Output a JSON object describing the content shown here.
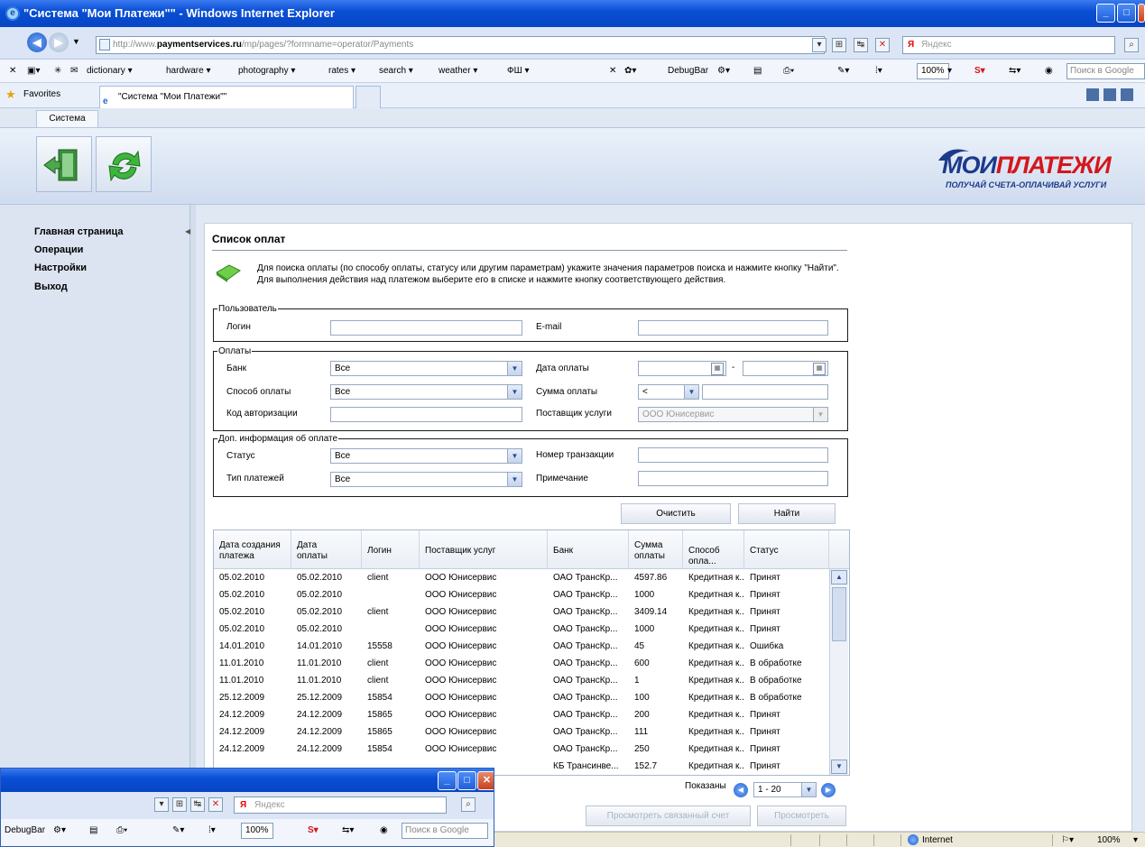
{
  "window": {
    "title": "\"Система \"Мои Платежи\"\" - Windows Internet Explorer"
  },
  "address": {
    "host_prefix": "http://www.",
    "host": "paymentservices.ru",
    "path": "/mp/pages/?formname=operator/Payments"
  },
  "yandex": {
    "logo": "Я",
    "placeholder": "Яндекс"
  },
  "links_toolbar": {
    "items": [
      "dictionary ▾",
      "hardware ▾",
      "photography ▾",
      "rates ▾",
      "search ▾",
      "weather ▾",
      "ФШ ▾"
    ],
    "debugbar": "DebugBar",
    "zoom": "100%",
    "google_placeholder": "Поиск в Google"
  },
  "favorites": {
    "label": "Favorites",
    "tab_title": "\"Система \"Мои Платежи\"\""
  },
  "app": {
    "top_tab": "Система",
    "logo_main_1": "МОИ",
    "logo_main_2": "ПЛАТЕЖИ",
    "logo_slogan": "ПОЛУЧАЙ СЧЕТА-ОПЛАЧИВАЙ УСЛУГИ"
  },
  "sidebar": {
    "items": [
      "Главная страница",
      "Операции",
      "Настройки",
      "Выход"
    ]
  },
  "page": {
    "title": "Список оплат",
    "info": "Для поиска оплаты (по способу оплаты, статусу или другим параметрам) укажите значения параметров поиска и нажмите кнопку \"Найти\". Для выполнения действия над платежом выберите его в списке и нажмите кнопку соответствующего действия."
  },
  "filters": {
    "user": {
      "legend": "Пользователь",
      "login_label": "Логин",
      "email_label": "E-mail"
    },
    "payments": {
      "legend": "Оплаты",
      "bank_label": "Банк",
      "bank_value": "Все",
      "method_label": "Способ оплаты",
      "method_value": "Все",
      "auth_label": "Код авторизации",
      "date_label": "Дата оплаты",
      "date_sep": "-",
      "sum_label": "Сумма оплаты",
      "sum_op": "<",
      "provider_label": "Поставщик услуги",
      "provider_value": "ООО Юнисервис"
    },
    "extra": {
      "legend": "Доп. информация об оплате",
      "status_label": "Статус",
      "status_value": "Все",
      "type_label": "Тип платежей",
      "type_value": "Все",
      "txn_label": "Номер транзакции",
      "note_label": "Примечание"
    }
  },
  "buttons": {
    "clear": "Очистить",
    "find": "Найти",
    "view_invoice": "Просмотреть связанный счет",
    "view": "Просмотреть"
  },
  "grid": {
    "headers": [
      [
        "Дата создания",
        "платежа"
      ],
      [
        "Дата",
        "оплаты"
      ],
      [
        "Логин",
        ""
      ],
      [
        "Поставщик услуг",
        ""
      ],
      [
        "Банк",
        ""
      ],
      [
        "Сумма",
        "оплаты"
      ],
      [
        "Способ опла...",
        ""
      ],
      [
        "Статус",
        ""
      ]
    ],
    "rows": [
      [
        "05.02.2010",
        "05.02.2010",
        "client",
        "ООО Юнисервис",
        "ОАО ТрансКр...",
        "4597.86",
        "Кредитная к...",
        "Принят"
      ],
      [
        "05.02.2010",
        "05.02.2010",
        "",
        "ООО Юнисервис",
        "ОАО ТрансКр...",
        "1000",
        "Кредитная к...",
        "Принят"
      ],
      [
        "05.02.2010",
        "05.02.2010",
        "client",
        "ООО Юнисервис",
        "ОАО ТрансКр...",
        "3409.14",
        "Кредитная к...",
        "Принят"
      ],
      [
        "05.02.2010",
        "05.02.2010",
        "",
        "ООО Юнисервис",
        "ОАО ТрансКр...",
        "1000",
        "Кредитная к...",
        "Принят"
      ],
      [
        "14.01.2010",
        "14.01.2010",
        "15558",
        "ООО Юнисервис",
        "ОАО ТрансКр...",
        "45",
        "Кредитная к...",
        "Ошибка"
      ],
      [
        "11.01.2010",
        "11.01.2010",
        "client",
        "ООО Юнисервис",
        "ОАО ТрансКр...",
        "600",
        "Кредитная к...",
        "В обработке"
      ],
      [
        "11.01.2010",
        "11.01.2010",
        "client",
        "ООО Юнисервис",
        "ОАО ТрансКр...",
        "1",
        "Кредитная к...",
        "В обработке"
      ],
      [
        "25.12.2009",
        "25.12.2009",
        "15854",
        "ООО Юнисервис",
        "ОАО ТрансКр...",
        "100",
        "Кредитная к...",
        "В обработке"
      ],
      [
        "24.12.2009",
        "24.12.2009",
        "15865",
        "ООО Юнисервис",
        "ОАО ТрансКр...",
        "200",
        "Кредитная к...",
        "Принят"
      ],
      [
        "24.12.2009",
        "24.12.2009",
        "15865",
        "ООО Юнисервис",
        "ОАО ТрансКр...",
        "111",
        "Кредитная к...",
        "Принят"
      ],
      [
        "24.12.2009",
        "24.12.2009",
        "15854",
        "ООО Юнисервис",
        "ОАО ТрансКр...",
        "250",
        "Кредитная к...",
        "Принят"
      ],
      [
        "",
        "",
        "",
        "",
        "КБ Трансинве...",
        "152.7",
        "Кредитная к...",
        "Принят"
      ]
    ]
  },
  "pager": {
    "label": "Показаны",
    "range": "1 - 20"
  },
  "statusbar": {
    "zone": "Internet",
    "zoom": "100%"
  },
  "window2": {
    "yandex_placeholder": "Яндекс",
    "debugbar": "DebugBar",
    "zoom": "100%",
    "google_placeholder": "Поиск в Google"
  }
}
